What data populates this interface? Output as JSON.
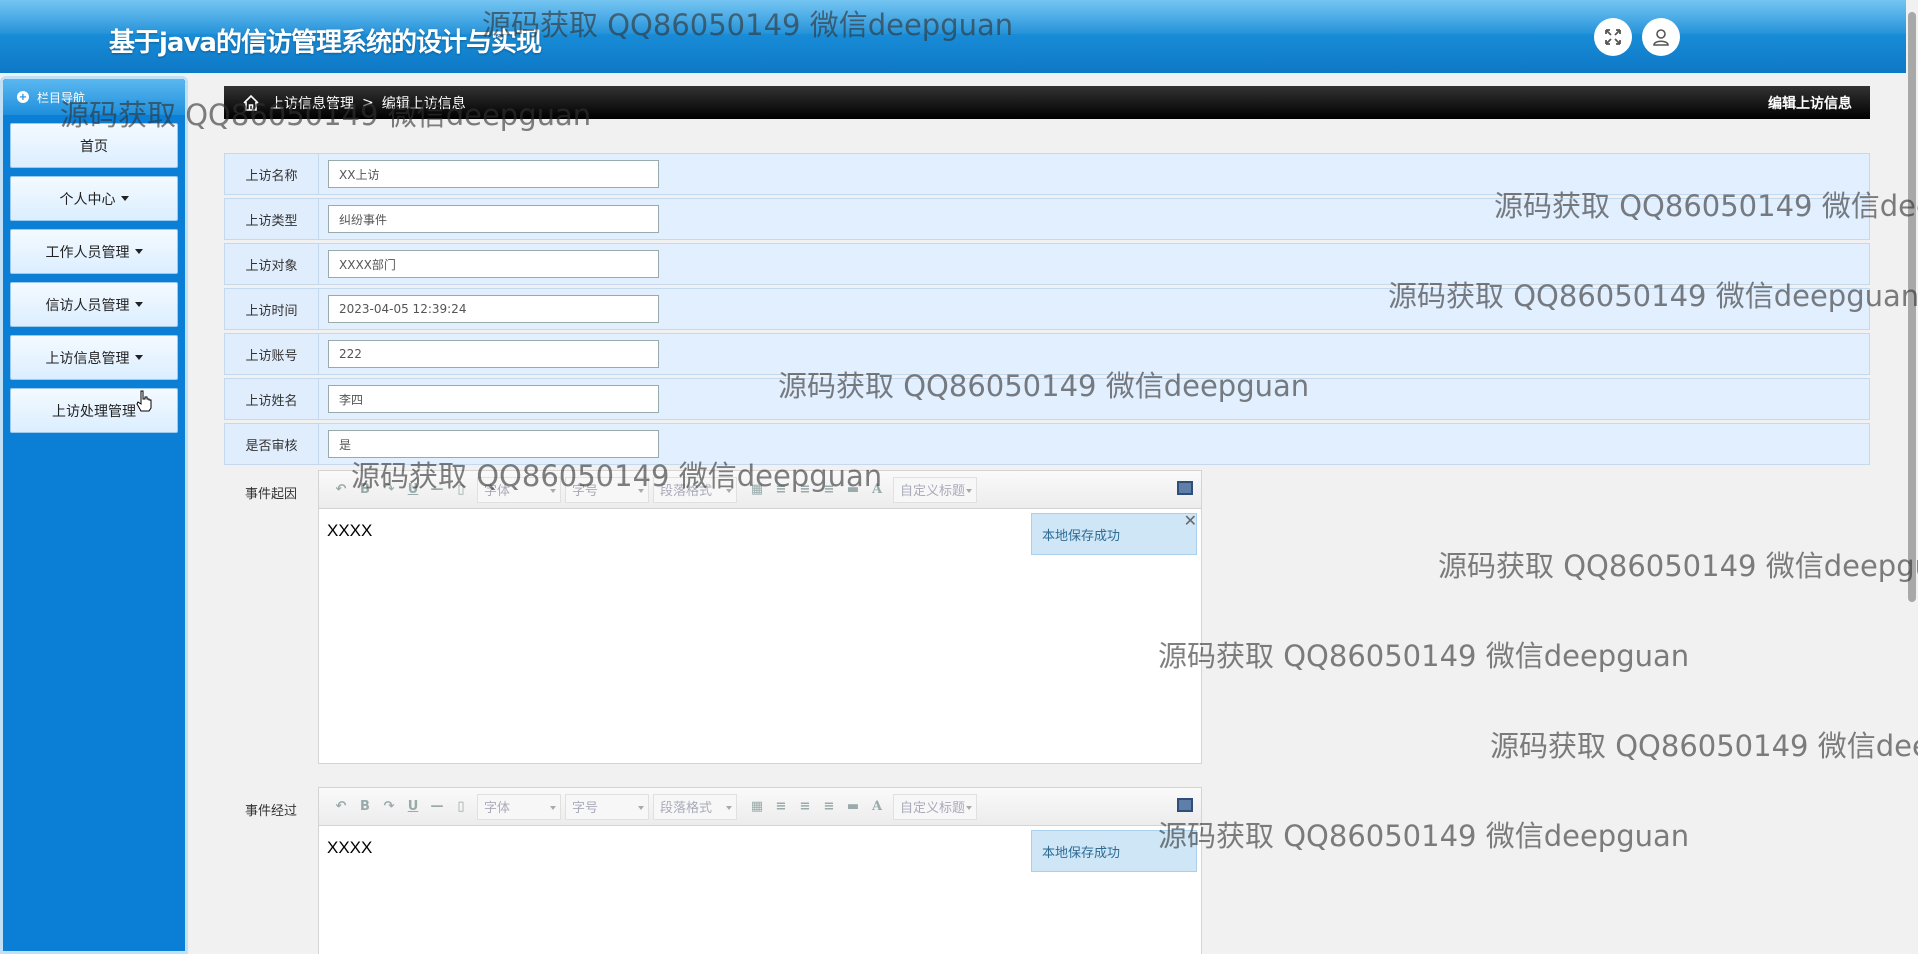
{
  "header": {
    "title": "基于java的信访管理系统的设计与实现",
    "fullscreen_icon": "expand-icon",
    "user_icon": "user-icon"
  },
  "sidebar": {
    "header": "栏目导航",
    "items": [
      {
        "label": "首页",
        "has_caret": false
      },
      {
        "label": "个人中心",
        "has_caret": true
      },
      {
        "label": "工作人员管理",
        "has_caret": true
      },
      {
        "label": "信访人员管理",
        "has_caret": true
      },
      {
        "label": "上访信息管理",
        "has_caret": true
      },
      {
        "label": "上访处理管理",
        "has_caret": false
      }
    ]
  },
  "breadcrumb": {
    "parent": "上访信息管理",
    "separator": ">",
    "current": "编辑上访信息",
    "right_title": "编辑上访信息"
  },
  "form": {
    "fields": [
      {
        "label": "上访名称",
        "value": "XX上访"
      },
      {
        "label": "上访类型",
        "value": "纠纷事件"
      },
      {
        "label": "上访对象",
        "value": "XXXX部门"
      },
      {
        "label": "上访时间",
        "value": "2023-04-05 12:39:24"
      },
      {
        "label": "上访账号",
        "value": "222"
      },
      {
        "label": "上访姓名",
        "value": "李四"
      },
      {
        "label": "是否审核",
        "value": "是"
      }
    ]
  },
  "editors": [
    {
      "label": "事件起因",
      "content": "XXXX",
      "toast": "本地保存成功",
      "show_close": true
    },
    {
      "label": "事件经过",
      "content": "XXXX",
      "toast": "本地保存成功",
      "show_close": false
    }
  ],
  "toolbar": {
    "bold": "B",
    "underline": "U",
    "font_family": "字体",
    "font_size": "字号",
    "paragraph": "段落格式",
    "font_color": "A",
    "custom_title": "自定义标题"
  },
  "watermark": "源码获取 QQ86050149 微信deepguan"
}
